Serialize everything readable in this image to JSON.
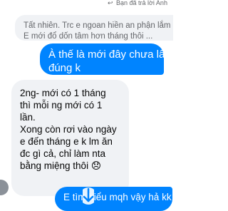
{
  "reply_header": {
    "icon": "reply-icon",
    "text": "Bạn đã trả lời Anh"
  },
  "quoted_message": {
    "lines": [
      "Tất nhiên. Trc e ngoan hiền an phận lắm",
      "E mới đổ dốn tâm hơn tháng thôi ..."
    ]
  },
  "outgoing_message_1": {
    "lines": [
      "À thế là mới đây chưa lâu",
      "đúng k"
    ],
    "color": "#0084ff"
  },
  "incoming_message": {
    "lines": [
      "2ng- mới có 1 tháng",
      "thì mỗi ng mới có 1",
      "lần.",
      "Xong còn rơi vào ngày",
      "e đến tháng e k lm ăn",
      "đc gì cả, chỉ làm nta",
      "bằng miệng thôi 😞"
    ],
    "color": "#f0f2f5"
  },
  "outgoing_message_2": {
    "text": "E tìm hiểu mqh vậy hả kk"
  },
  "scroll_down": {
    "icon": "arrow-down-icon",
    "color": "#0084ff"
  }
}
